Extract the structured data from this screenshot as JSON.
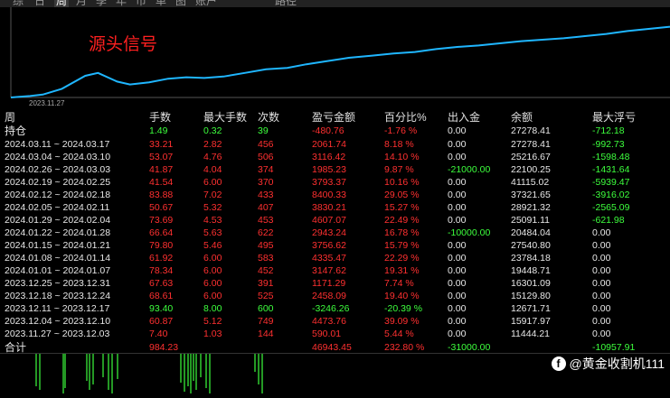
{
  "tabs": [
    {
      "label": "综",
      "active": false
    },
    {
      "label": "日",
      "active": false
    },
    {
      "label": "周",
      "active": true
    },
    {
      "label": "月",
      "active": false
    },
    {
      "label": "季",
      "active": false
    },
    {
      "label": "年",
      "active": false
    },
    {
      "label": "币",
      "active": false
    },
    {
      "label": "单",
      "active": false
    },
    {
      "label": "图",
      "active": false
    },
    {
      "label": "账户",
      "active": false
    },
    {
      "label": "路径",
      "active": false
    }
  ],
  "chart": {
    "title": "源头信号",
    "date_label": "2023.11.27",
    "line_color": "#1fb6ff",
    "points": [
      [
        0,
        100
      ],
      [
        8,
        99
      ],
      [
        18,
        98
      ],
      [
        30,
        96
      ],
      [
        48,
        88
      ],
      [
        70,
        70
      ],
      [
        82,
        66
      ],
      [
        100,
        78
      ],
      [
        112,
        82
      ],
      [
        130,
        79
      ],
      [
        148,
        74
      ],
      [
        165,
        72
      ],
      [
        182,
        73
      ],
      [
        200,
        71
      ],
      [
        220,
        66
      ],
      [
        240,
        61
      ],
      [
        260,
        59
      ],
      [
        278,
        54
      ],
      [
        300,
        49
      ],
      [
        318,
        45
      ],
      [
        340,
        42
      ],
      [
        360,
        39
      ],
      [
        380,
        37
      ],
      [
        400,
        33
      ],
      [
        420,
        30
      ],
      [
        440,
        28
      ],
      [
        460,
        25
      ],
      [
        480,
        22
      ],
      [
        500,
        20
      ],
      [
        520,
        18
      ],
      [
        540,
        15
      ],
      [
        560,
        12
      ],
      [
        580,
        8
      ],
      [
        600,
        5
      ],
      [
        620,
        2
      ]
    ]
  },
  "colors": {
    "red": "#ff3030",
    "green": "#3dff3d",
    "white": "#e8e8e8",
    "header": "#e0e0e0"
  },
  "table": {
    "headers": [
      "周",
      "手数",
      "最大手数",
      "次数",
      "盈亏金额",
      "百分比%",
      "出入金",
      "余额",
      "最大浮亏"
    ],
    "hold": [
      "持仓",
      "1.49",
      "0.32",
      "39",
      "-480.76",
      "-1.76 %",
      "0.00",
      "27278.41",
      "-712.18"
    ],
    "rows": [
      {
        "week": "2024.03.11 ~ 2024.03.17",
        "lots": "33.21",
        "max": "2.82",
        "count": "456",
        "pnl": "2061.74",
        "pct": "8.18 %",
        "flow": "0.00",
        "bal": "27278.41",
        "dd": "-992.73"
      },
      {
        "week": "2024.03.04 ~ 2024.03.10",
        "lots": "53.07",
        "max": "4.76",
        "count": "506",
        "pnl": "3116.42",
        "pct": "14.10 %",
        "flow": "0.00",
        "bal": "25216.67",
        "dd": "-1598.48"
      },
      {
        "week": "2024.02.26 ~ 2024.03.03",
        "lots": "41.87",
        "max": "4.04",
        "count": "374",
        "pnl": "1985.23",
        "pct": "9.87 %",
        "flow": "-21000.00",
        "bal": "22100.25",
        "dd": "-1431.64"
      },
      {
        "week": "2024.02.19 ~ 2024.02.25",
        "lots": "41.54",
        "max": "6.00",
        "count": "370",
        "pnl": "3793.37",
        "pct": "10.16 %",
        "flow": "0.00",
        "bal": "41115.02",
        "dd": "-5939.47"
      },
      {
        "week": "2024.02.12 ~ 2024.02.18",
        "lots": "83.88",
        "max": "7.02",
        "count": "433",
        "pnl": "8400.33",
        "pct": "29.05 %",
        "flow": "0.00",
        "bal": "37321.65",
        "dd": "-3916.02"
      },
      {
        "week": "2024.02.05 ~ 2024.02.11",
        "lots": "50.67",
        "max": "5.32",
        "count": "407",
        "pnl": "3830.21",
        "pct": "15.27 %",
        "flow": "0.00",
        "bal": "28921.32",
        "dd": "-2565.09"
      },
      {
        "week": "2024.01.29 ~ 2024.02.04",
        "lots": "73.69",
        "max": "4.53",
        "count": "453",
        "pnl": "4607.07",
        "pct": "22.49 %",
        "flow": "0.00",
        "bal": "25091.11",
        "dd": "-621.98"
      },
      {
        "week": "2024.01.22 ~ 2024.01.28",
        "lots": "66.64",
        "max": "5.63",
        "count": "622",
        "pnl": "2943.24",
        "pct": "16.78 %",
        "flow": "-10000.00",
        "bal": "20484.04",
        "dd": "0.00"
      },
      {
        "week": "2024.01.15 ~ 2024.01.21",
        "lots": "79.80",
        "max": "5.46",
        "count": "495",
        "pnl": "3756.62",
        "pct": "15.79 %",
        "flow": "0.00",
        "bal": "27540.80",
        "dd": "0.00"
      },
      {
        "week": "2024.01.08 ~ 2024.01.14",
        "lots": "61.92",
        "max": "6.00",
        "count": "583",
        "pnl": "4335.47",
        "pct": "22.29 %",
        "flow": "0.00",
        "bal": "23784.18",
        "dd": "0.00"
      },
      {
        "week": "2024.01.01 ~ 2024.01.07",
        "lots": "78.34",
        "max": "6.00",
        "count": "452",
        "pnl": "3147.62",
        "pct": "19.31 %",
        "flow": "0.00",
        "bal": "19448.71",
        "dd": "0.00"
      },
      {
        "week": "2023.12.25 ~ 2023.12.31",
        "lots": "67.63",
        "max": "6.00",
        "count": "391",
        "pnl": "1171.29",
        "pct": "7.74 %",
        "flow": "0.00",
        "bal": "16301.09",
        "dd": "0.00"
      },
      {
        "week": "2023.12.18 ~ 2023.12.24",
        "lots": "68.61",
        "max": "6.00",
        "count": "525",
        "pnl": "2458.09",
        "pct": "19.40 %",
        "flow": "0.00",
        "bal": "15129.80",
        "dd": "0.00"
      },
      {
        "week": "2023.12.11 ~ 2023.12.17",
        "lots": "93.40",
        "max": "8.00",
        "count": "600",
        "pnl": "-3246.26",
        "pct": "-20.39 %",
        "flow": "0.00",
        "bal": "12671.71",
        "dd": "0.00"
      },
      {
        "week": "2023.12.04 ~ 2023.12.10",
        "lots": "60.87",
        "max": "5.12",
        "count": "749",
        "pnl": "4473.76",
        "pct": "39.09 %",
        "flow": "0.00",
        "bal": "15917.97",
        "dd": "0.00"
      },
      {
        "week": "2023.11.27 ~ 2023.12.03",
        "lots": "7.40",
        "max": "1.03",
        "count": "144",
        "pnl": "590.01",
        "pct": "5.44 %",
        "flow": "0.00",
        "bal": "11444.21",
        "dd": "0.00"
      }
    ],
    "total": {
      "label": "合计",
      "lots": "984.23",
      "pnl": "46943.45",
      "pct": "232.80 %",
      "flow": "-31000.00",
      "dd": "-10957.91"
    }
  },
  "watermark": {
    "icon": "facebook-icon",
    "text": "@黄金收割机111"
  }
}
